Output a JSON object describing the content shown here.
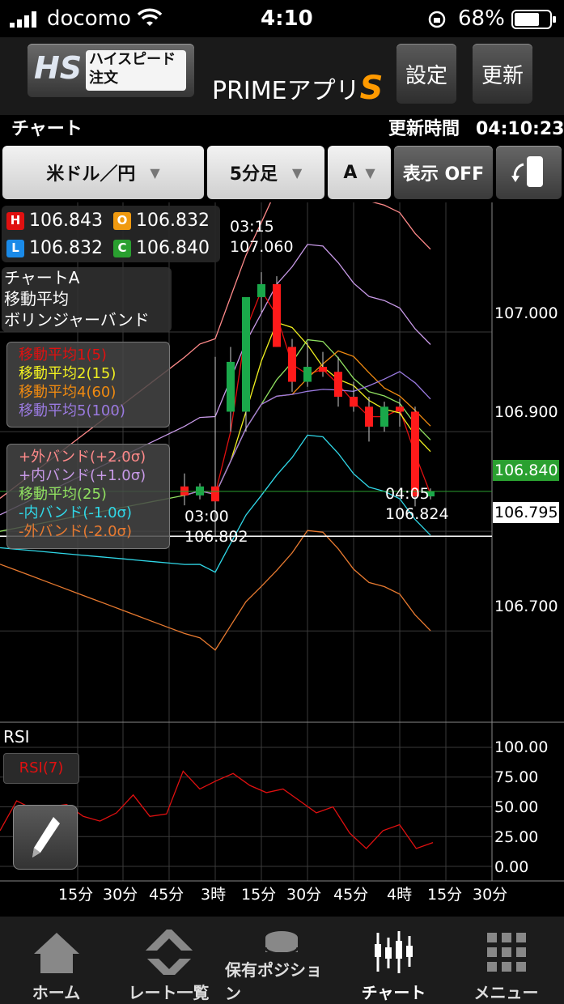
{
  "status_bar": {
    "carrier": "docomo",
    "time": "4:10",
    "battery": "68%"
  },
  "header": {
    "logo_mark": "HS",
    "logo_text_1": "ハイスピード",
    "logo_text_2": "注文",
    "app_title": "PRIMEアプリ",
    "app_title_mark": "S",
    "settings_label": "設定",
    "refresh_label": "更新"
  },
  "subheader": {
    "title": "チャート",
    "update_label": "更新時間",
    "update_time": "04:10:23"
  },
  "controls": {
    "pair": "米ドル／円",
    "timeframe": "5分足",
    "chart_slot": "A",
    "display_toggle": "表示 OFF"
  },
  "ohlc": {
    "high_badge": "H",
    "high": "106.843",
    "open_badge": "O",
    "open": "106.832",
    "low_badge": "L",
    "low": "106.832",
    "close_badge": "C",
    "close": "106.840"
  },
  "chart_info": {
    "name": "チャートA",
    "indicator_1": "移動平均",
    "indicator_2": "ボリンジャーバンド"
  },
  "ma_legend": [
    "移動平均1(5)",
    "移動平均2(15)",
    "移動平均4(60)",
    "移動平均5(100)"
  ],
  "bb_legend": [
    "+外バンド(+2.0σ)",
    "+内バンド(+1.0σ)",
    "移動平均(25)",
    "-内バンド(-1.0σ)",
    "-外バンド(-2.0σ)"
  ],
  "annotations": {
    "high_time": "03:15",
    "high_value": "107.060",
    "low_time": "03:00",
    "low_value": "106.802",
    "last_time": "04:05",
    "last_value": "106.824"
  },
  "price_axis": {
    "ticks": [
      "107.000",
      "106.900",
      "106.700"
    ],
    "current_price": "106.840",
    "crosshair_price": "106.795"
  },
  "rsi_panel": {
    "title": "RSI",
    "legend": "RSI(7)",
    "ticks": [
      "100.00",
      "75.00",
      "50.00",
      "25.00",
      "0.00"
    ]
  },
  "time_axis": [
    "15分",
    "30分",
    "45分",
    "3時",
    "15分",
    "30分",
    "45分",
    "4時",
    "15分",
    "30分"
  ],
  "bottom_nav": [
    {
      "label": "ホーム",
      "icon": "home-icon"
    },
    {
      "label": "レート一覧",
      "icon": "rate-list-icon"
    },
    {
      "label": "保有ポジション",
      "icon": "coins-icon"
    },
    {
      "label": "チャート",
      "icon": "chart-icon"
    },
    {
      "label": "メニュー",
      "icon": "menu-grid-icon"
    }
  ],
  "colors": {
    "bull": "#1aa84a",
    "bear": "#ff1a1a",
    "ma1": "#e01010",
    "ma2": "#f0f020",
    "ma4": "#f08a10",
    "ma5": "#9a7ae0",
    "bb_outer_plus": "#ff8a8a",
    "bb_inner_plus": "#c89ae8",
    "bb_mid": "#90e060",
    "bb_inner_minus": "#30d8e8",
    "bb_outer_minus": "#e87a30",
    "price_tag": "#2aa030",
    "rsi": "#e01010"
  },
  "chart_data": {
    "type": "candlestick",
    "price_ylim": [
      106.61,
      107.13
    ],
    "candles": [
      {
        "o": 106.845,
        "h": 106.858,
        "l": 106.826,
        "c": 106.836
      },
      {
        "o": 106.836,
        "h": 106.848,
        "l": 106.832,
        "c": 106.845
      },
      {
        "o": 106.845,
        "h": 106.975,
        "l": 106.795,
        "c": 106.83
      },
      {
        "o": 106.92,
        "h": 106.985,
        "l": 106.9,
        "c": 106.97
      },
      {
        "o": 106.92,
        "h": 107.03,
        "l": 106.9,
        "c": 107.035
      },
      {
        "o": 107.035,
        "h": 107.06,
        "l": 107.02,
        "c": 107.048
      },
      {
        "o": 107.048,
        "h": 107.056,
        "l": 106.985,
        "c": 106.985
      },
      {
        "o": 106.985,
        "h": 106.993,
        "l": 106.94,
        "c": 106.95
      },
      {
        "o": 106.95,
        "h": 106.99,
        "l": 106.945,
        "c": 106.965
      },
      {
        "o": 106.965,
        "h": 106.98,
        "l": 106.955,
        "c": 106.96
      },
      {
        "o": 106.96,
        "h": 106.975,
        "l": 106.925,
        "c": 106.935
      },
      {
        "o": 106.935,
        "h": 106.95,
        "l": 106.92,
        "c": 106.925
      },
      {
        "o": 106.925,
        "h": 106.935,
        "l": 106.89,
        "c": 106.905
      },
      {
        "o": 106.905,
        "h": 106.93,
        "l": 106.9,
        "c": 106.925
      },
      {
        "o": 106.925,
        "h": 106.933,
        "l": 106.905,
        "c": 106.92
      },
      {
        "o": 106.92,
        "h": 106.925,
        "l": 106.825,
        "c": 106.835
      },
      {
        "o": 106.835,
        "h": 106.843,
        "l": 106.832,
        "c": 106.84
      }
    ],
    "rsi_values": [
      30,
      55,
      48,
      50,
      52,
      42,
      38,
      45,
      60,
      42,
      44,
      80,
      65,
      72,
      78,
      68,
      62,
      65,
      55,
      45,
      50,
      28,
      15,
      30,
      35,
      15,
      20
    ],
    "rsi_ylim": [
      0,
      100
    ],
    "grid": true
  }
}
